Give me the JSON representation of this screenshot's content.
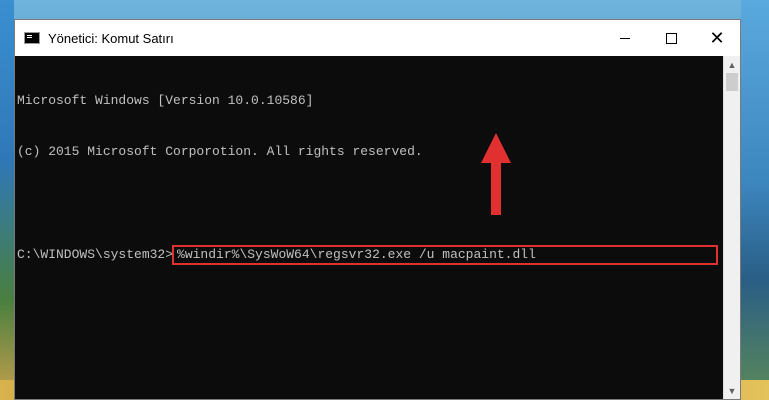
{
  "window": {
    "title": "Yönetici: Komut Satırı",
    "controls": {
      "minimize": "—",
      "maximize": "☐",
      "close": "✕"
    }
  },
  "console": {
    "lines": [
      "Microsoft Windows [Version 10.0.10586]",
      "(c) 2015 Microsoft Corporotion. All rights reserved."
    ],
    "prompt": "C:\\WINDOWS\\system32>",
    "command": "%windir%\\SysWoW64\\regsvr32.exe /u macpaint.dll"
  },
  "annotation": {
    "color": "#e03030",
    "icon": "red-up-arrow-icon"
  },
  "scrollbar": {
    "up_glyph": "▲",
    "down_glyph": "▼"
  }
}
